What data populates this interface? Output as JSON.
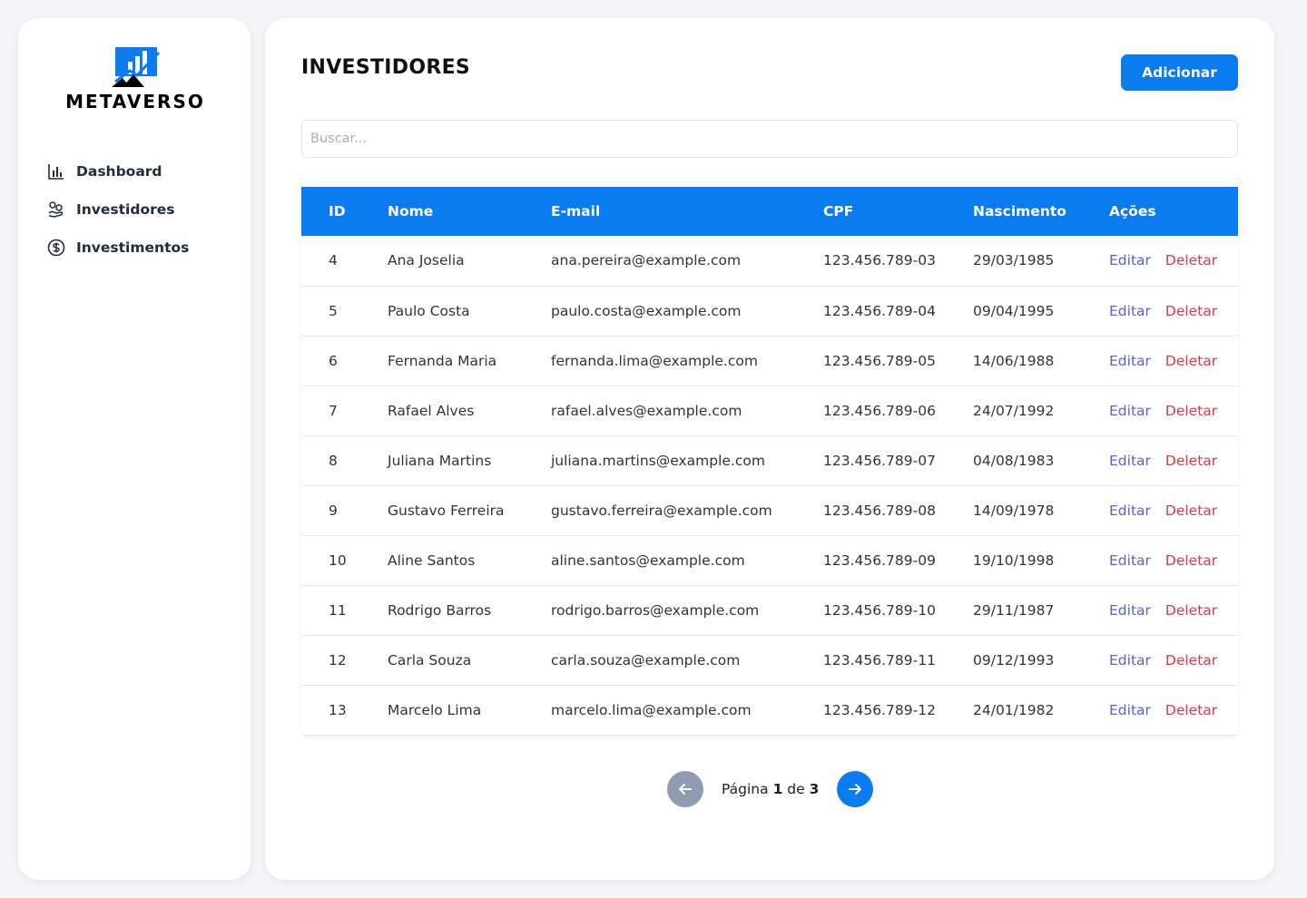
{
  "brand": {
    "name": "METAVERSO",
    "accent": "#0a7cf0"
  },
  "sidebar": {
    "items": [
      {
        "label": "Dashboard",
        "icon": "bar-chart-icon"
      },
      {
        "label": "Investidores",
        "icon": "hand-coins-icon"
      },
      {
        "label": "Investimentos",
        "icon": "dollar-circle-icon"
      }
    ]
  },
  "header": {
    "title": "INVESTIDORES",
    "add_label": "Adicionar"
  },
  "search": {
    "placeholder": "Buscar..."
  },
  "table": {
    "columns": [
      "ID",
      "Nome",
      "E-mail",
      "CPF",
      "Nascimento",
      "Ações"
    ],
    "rows": [
      {
        "id": "4",
        "nome": "Ana Joselia",
        "email": "ana.pereira@example.com",
        "cpf": "123.456.789-03",
        "nascimento": "29/03/1985"
      },
      {
        "id": "5",
        "nome": "Paulo Costa",
        "email": "paulo.costa@example.com",
        "cpf": "123.456.789-04",
        "nascimento": "09/04/1995"
      },
      {
        "id": "6",
        "nome": "Fernanda Maria",
        "email": "fernanda.lima@example.com",
        "cpf": "123.456.789-05",
        "nascimento": "14/06/1988"
      },
      {
        "id": "7",
        "nome": "Rafael Alves",
        "email": "rafael.alves@example.com",
        "cpf": "123.456.789-06",
        "nascimento": "24/07/1992"
      },
      {
        "id": "8",
        "nome": "Juliana Martins",
        "email": "juliana.martins@example.com",
        "cpf": "123.456.789-07",
        "nascimento": "04/08/1983"
      },
      {
        "id": "9",
        "nome": "Gustavo Ferreira",
        "email": "gustavo.ferreira@example.com",
        "cpf": "123.456.789-08",
        "nascimento": "14/09/1978"
      },
      {
        "id": "10",
        "nome": "Aline Santos",
        "email": "aline.santos@example.com",
        "cpf": "123.456.789-09",
        "nascimento": "19/10/1998"
      },
      {
        "id": "11",
        "nome": "Rodrigo Barros",
        "email": "rodrigo.barros@example.com",
        "cpf": "123.456.789-10",
        "nascimento": "29/11/1987"
      },
      {
        "id": "12",
        "nome": "Carla Souza",
        "email": "carla.souza@example.com",
        "cpf": "123.456.789-11",
        "nascimento": "09/12/1993"
      },
      {
        "id": "13",
        "nome": "Marcelo Lima",
        "email": "marcelo.lima@example.com",
        "cpf": "123.456.789-12",
        "nascimento": "24/01/1982"
      }
    ],
    "edit_label": "Editar",
    "delete_label": "Deletar"
  },
  "pagination": {
    "prefix": "Página",
    "current": "1",
    "separator": "de",
    "total": "3",
    "prev_icon": "arrow-left-icon",
    "next_icon": "arrow-right-icon"
  }
}
